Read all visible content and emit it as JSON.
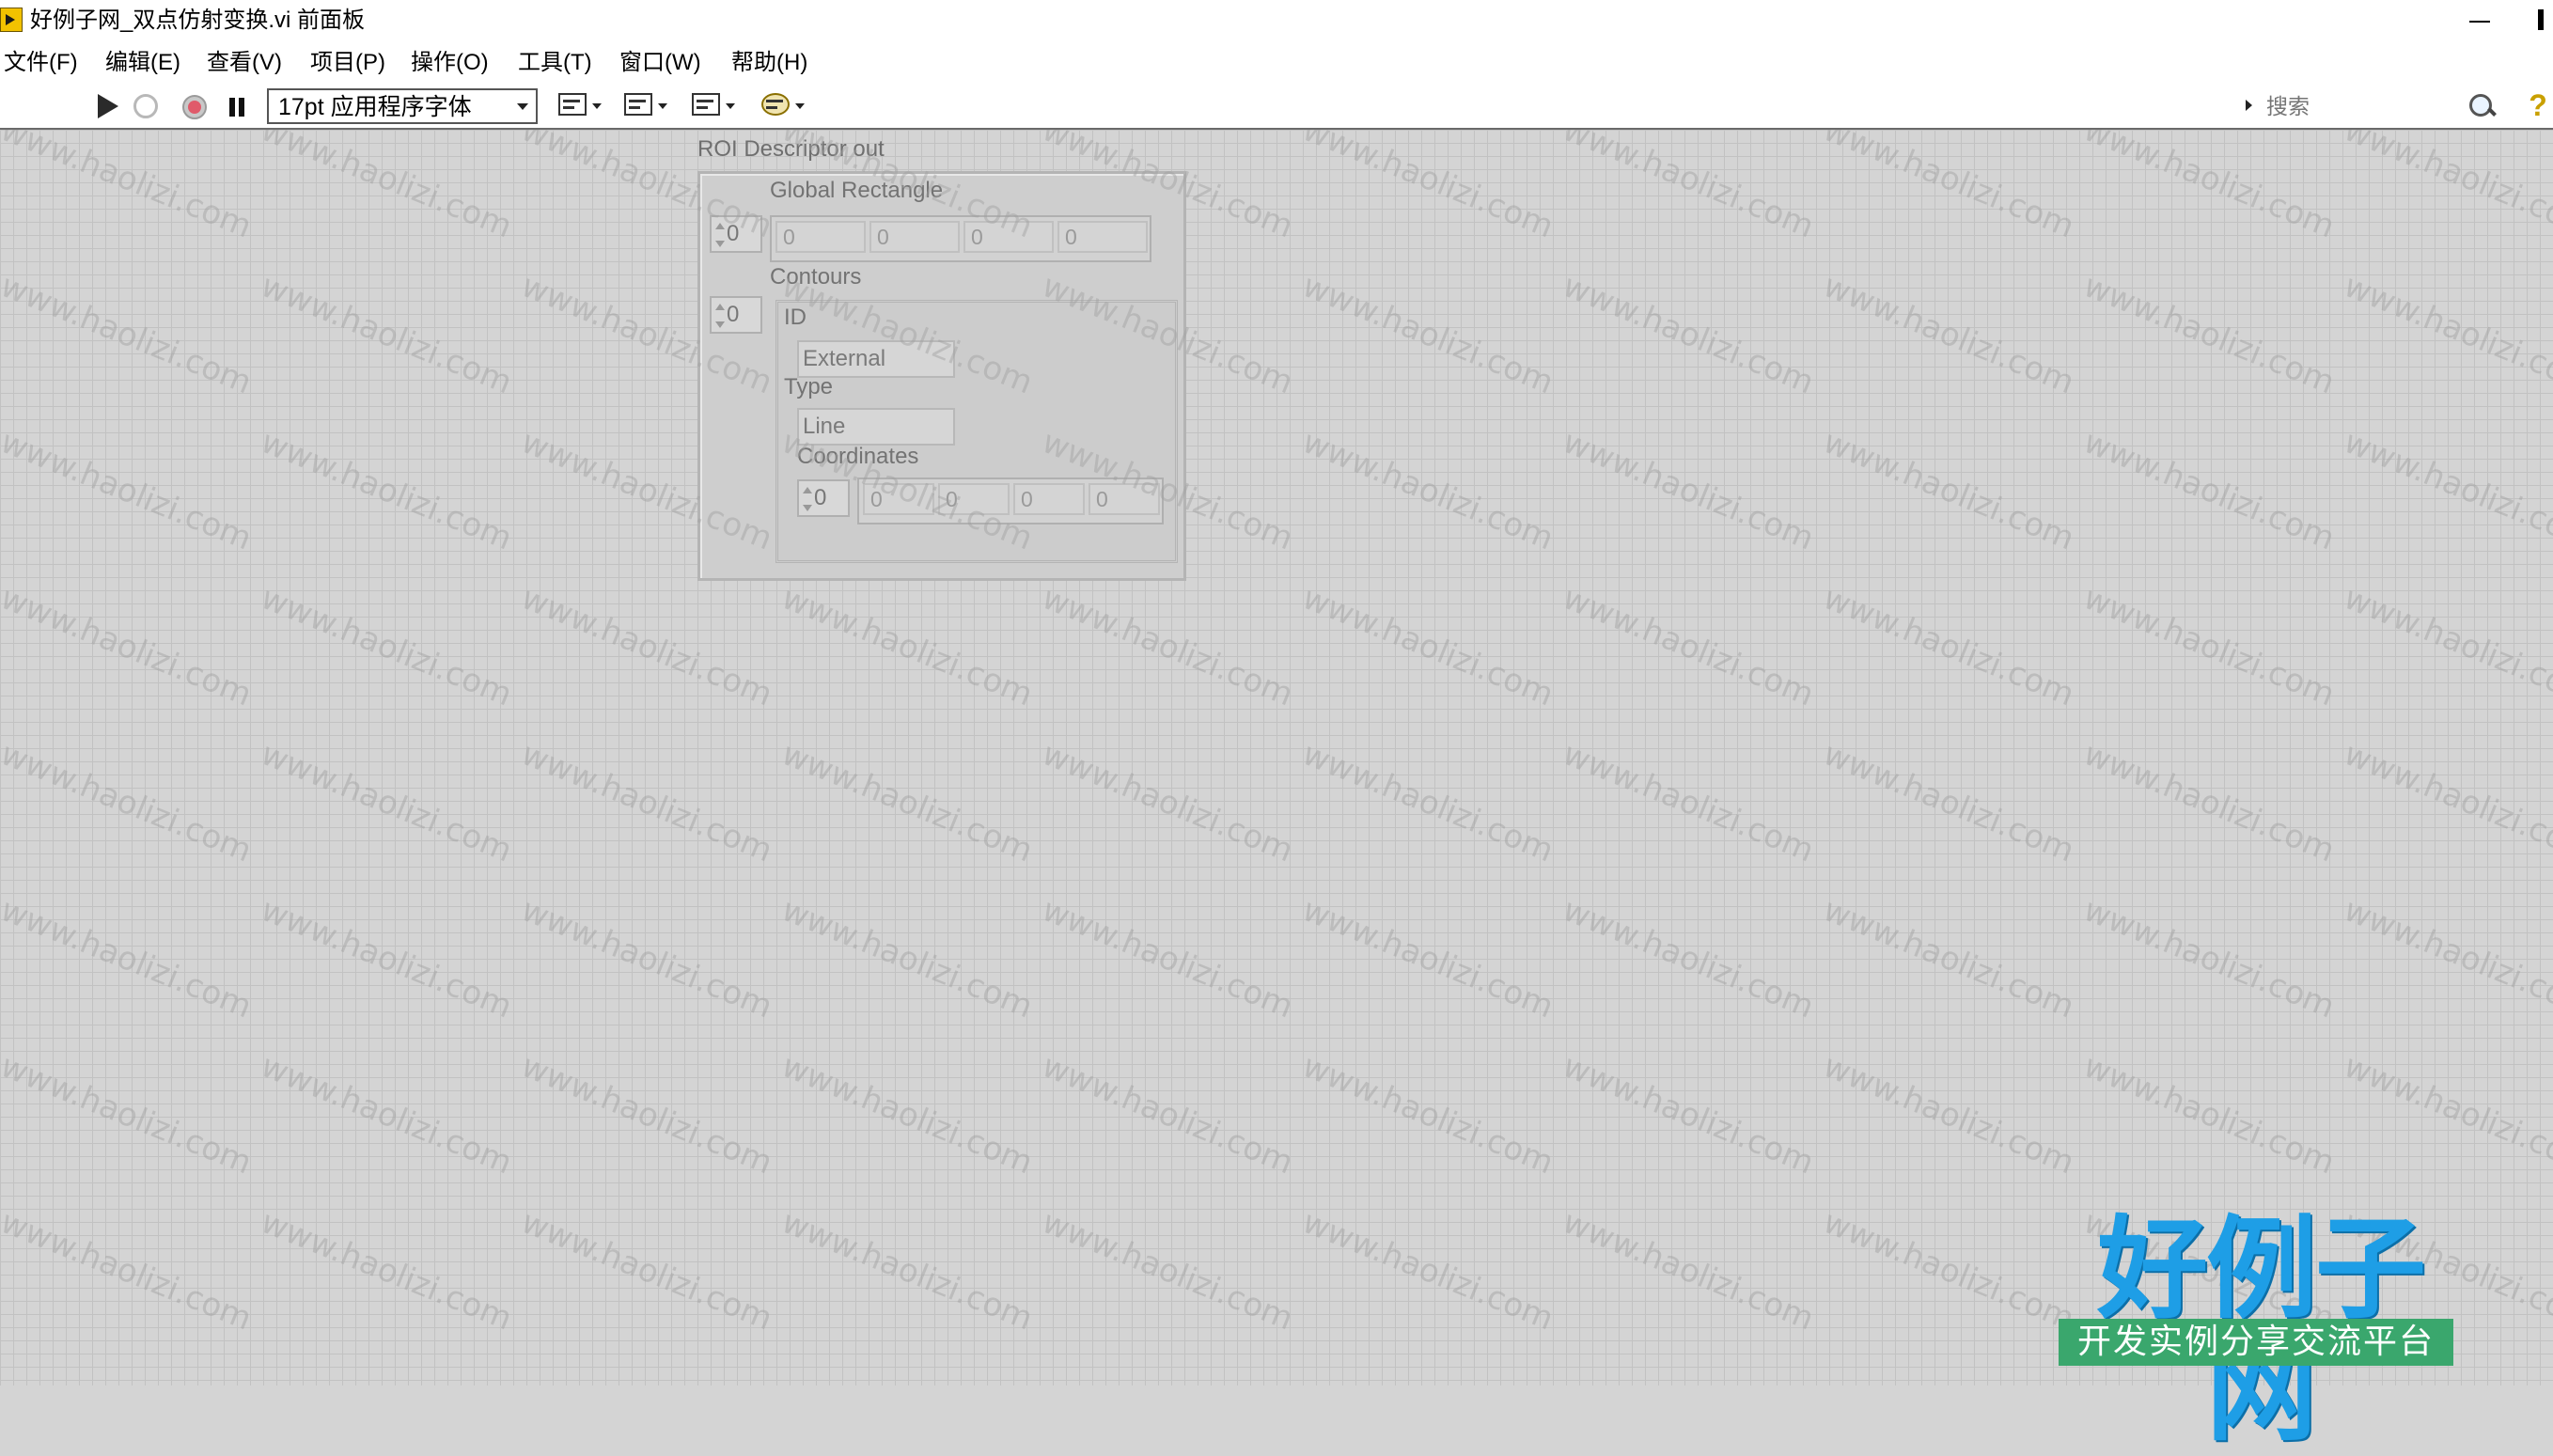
{
  "window": {
    "title": "好例子网_双点仿射变换.vi 前面板"
  },
  "menu": [
    {
      "label": "文件(F)"
    },
    {
      "label": "编辑(E)"
    },
    {
      "label": "查看(V)"
    },
    {
      "label": "项目(P)"
    },
    {
      "label": "操作(O)"
    },
    {
      "label": "工具(T)"
    },
    {
      "label": "窗口(W)"
    },
    {
      "label": "帮助(H)"
    }
  ],
  "toolbar": {
    "font_select": "17pt 应用程序字体",
    "search_placeholder": "搜索",
    "help_glyph": "?",
    "icons": [
      "run-arrow-icon",
      "run-continuously-icon",
      "abort-icon",
      "pause-icon",
      "align-objects-icon",
      "distribute-objects-icon",
      "resize-objects-icon",
      "reorder-icon"
    ]
  },
  "roi": {
    "label": "ROI Descriptor out",
    "global_rectangle": {
      "label": "Global Rectangle",
      "index": "0",
      "values": [
        "0",
        "0",
        "0",
        "0"
      ]
    },
    "contours": {
      "label": "Contours",
      "index": "0",
      "id_label": "ID",
      "id_value": "External",
      "type_label": "Type",
      "type_value": "Line",
      "coordinates_label": "Coordinates",
      "coordinates_index": "0",
      "coordinates_values": [
        "0",
        "0",
        "0",
        "0"
      ]
    }
  },
  "watermark": {
    "text": "www.haolizi.com"
  },
  "logo": {
    "main": "好例子网",
    "sub": "开发实例分享交流平台"
  }
}
